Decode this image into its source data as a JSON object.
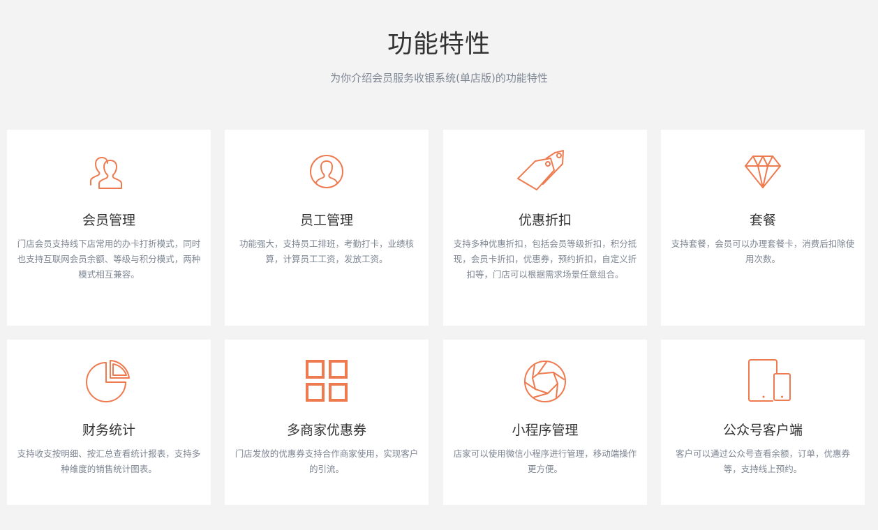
{
  "header": {
    "title": "功能特性",
    "subtitle": "为你介绍会员服务收银系统(单店版)的功能特性"
  },
  "accent_color": "#ee7a4f",
  "features": [
    {
      "icon": "members-icon",
      "title": "会员管理",
      "desc": "门店会员支持线下店常用的办卡打折模式，同时也支持互联网会员余额、等级与积分模式，两种模式相互兼容。"
    },
    {
      "icon": "employee-icon",
      "title": "员工管理",
      "desc": "功能强大，支持员工排班，考勤打卡，业绩核算，计算员工工资，发放工资。"
    },
    {
      "icon": "price-tags-icon",
      "title": "优惠折扣",
      "desc": "支持多种优惠折扣，包括会员等级折扣，积分抵现，会员卡折扣，优惠券，预约折扣，自定义折扣等，门店可以根据需求场景任意组合。"
    },
    {
      "icon": "diamond-icon",
      "title": "套餐",
      "desc": "支持套餐，会员可以办理套餐卡，消费后扣除使用次数。"
    },
    {
      "icon": "pie-chart-icon",
      "title": "财务统计",
      "desc": "支持收支按明细、按汇总查看统计报表，支持多种维度的销售统计图表。"
    },
    {
      "icon": "grid-icon",
      "title": "多商家优惠券",
      "desc": "门店发放的优惠券支持合作商家使用，实现客户的引流。"
    },
    {
      "icon": "aperture-icon",
      "title": "小程序管理",
      "desc": "店家可以使用微信小程序进行管理，移动端操作更方便。"
    },
    {
      "icon": "devices-icon",
      "title": "公众号客户端",
      "desc": "客户可以通过公众号查看余额，订单，优惠券等，支持线上预约。"
    }
  ]
}
